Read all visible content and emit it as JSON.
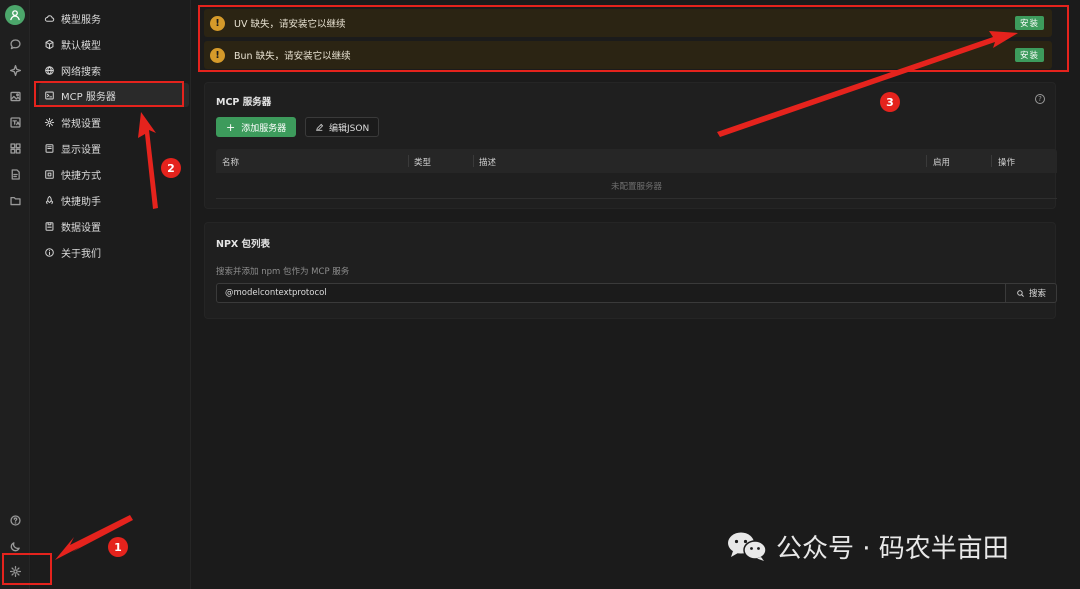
{
  "menu": {
    "items": [
      {
        "label": "模型服务",
        "icon": "cloud-icon"
      },
      {
        "label": "默认模型",
        "icon": "cube-icon"
      },
      {
        "label": "网络搜索",
        "icon": "globe-icon"
      },
      {
        "label": "MCP 服务器",
        "icon": "terminal-icon"
      },
      {
        "label": "常规设置",
        "icon": "gear-icon"
      },
      {
        "label": "显示设置",
        "icon": "display-icon"
      },
      {
        "label": "快捷方式",
        "icon": "command-icon"
      },
      {
        "label": "快捷助手",
        "icon": "rocket-icon"
      },
      {
        "label": "数据设置",
        "icon": "database-icon"
      },
      {
        "label": "关于我们",
        "icon": "info-icon"
      }
    ]
  },
  "alerts": [
    {
      "text": "UV 缺失，请安装它以继续",
      "button": "安装"
    },
    {
      "text": "Bun 缺失，请安装它以继续",
      "button": "安装"
    }
  ],
  "mcp": {
    "title": "MCP 服务器",
    "add_button": "添加服务器",
    "edit_button": "编辑JSON",
    "columns": [
      "名称",
      "类型",
      "描述",
      "启用",
      "操作"
    ],
    "empty_text": "未配置服务器"
  },
  "npx": {
    "title": "NPX 包列表",
    "description": "搜索并添加 npm 包作为 MCP 服务",
    "search_value": "@modelcontextprotocol",
    "search_button": "搜索"
  },
  "annotations": {
    "badge1": "1",
    "badge2": "2",
    "badge3": "3",
    "color": "#e5231d"
  },
  "watermark": {
    "text": "公众号 · 码农半亩田"
  },
  "colors": {
    "accent_green": "#3d9b5c",
    "warning": "#d59a2a"
  }
}
